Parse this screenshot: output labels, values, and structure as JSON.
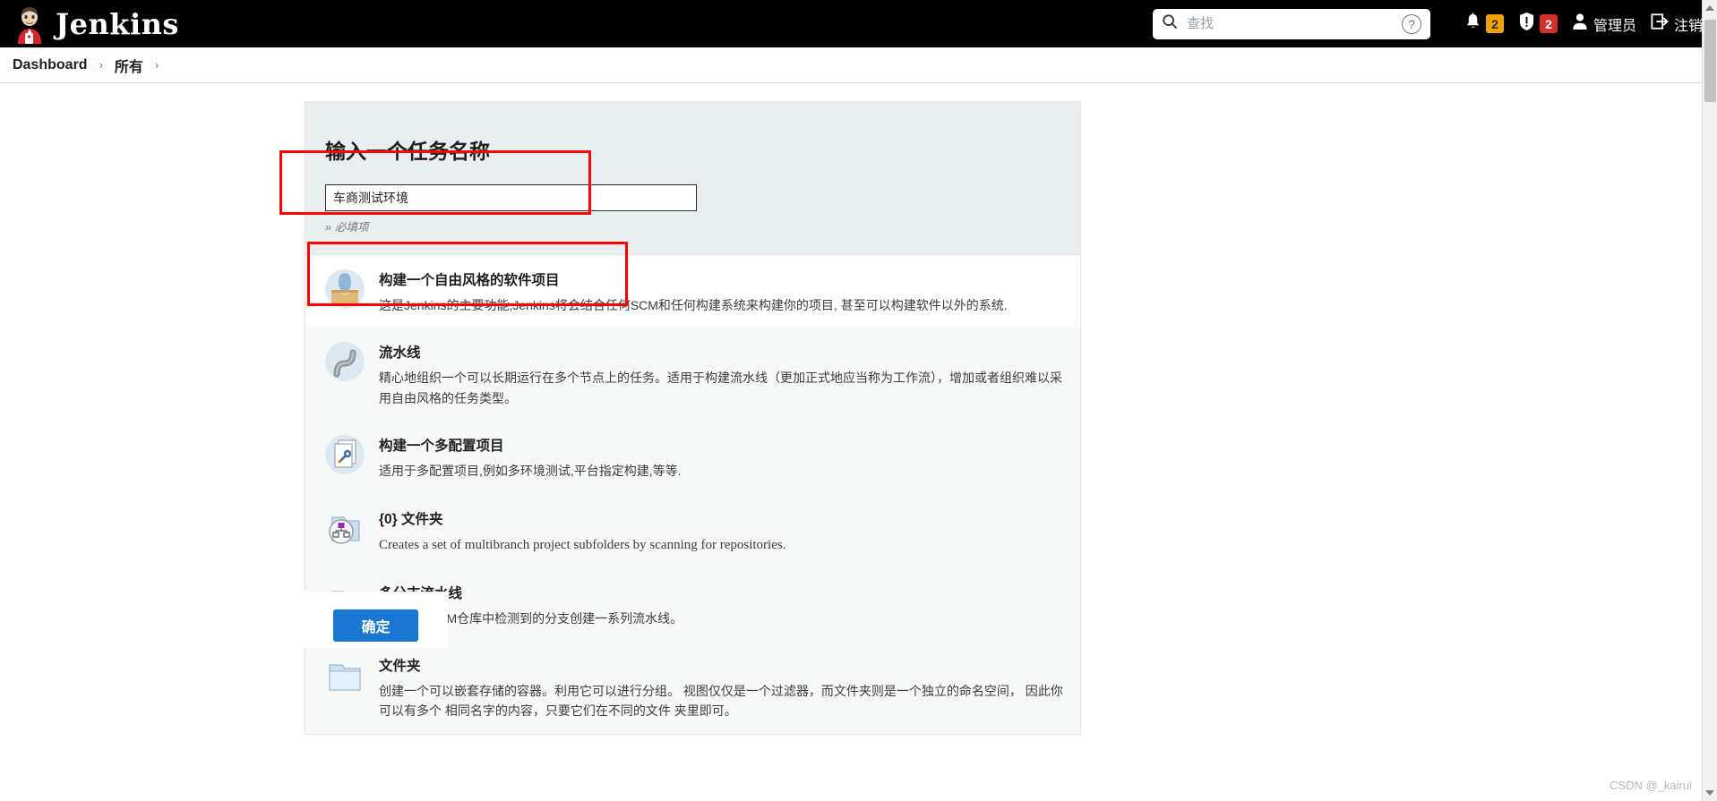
{
  "header": {
    "brand": "Jenkins",
    "logo_icon": "jenkins-butler-logo",
    "search": {
      "placeholder": "查找",
      "value": "",
      "icon": "search-icon",
      "help_icon": "help-circle-icon"
    },
    "notifications": {
      "icon": "bell-icon",
      "count": "2",
      "color": "#f0a202"
    },
    "security": {
      "icon": "shield-alert-icon",
      "count": "2",
      "color": "#d32f2f"
    },
    "user": {
      "icon": "person-icon",
      "label": "管理员"
    },
    "logout": {
      "icon": "logout-icon",
      "label": "注销"
    }
  },
  "breadcrumb": {
    "items": [
      "Dashboard",
      "所有"
    ],
    "separator": "›"
  },
  "dialog": {
    "title": "输入一个任务名称",
    "name_input": {
      "value": "车商测试环境",
      "placeholder": ""
    },
    "required_note": "必填项",
    "required_chevron": "»",
    "items": [
      {
        "icon": "freestyle-project-icon",
        "title": "构建一个自由风格的软件项目",
        "desc": "这是Jenkins的主要功能,Jenkins将会结合任何SCM和任何构建系统来构建你的项目, 甚至可以构建软件以外的系统.",
        "selected": true
      },
      {
        "icon": "pipeline-icon",
        "title": "流水线",
        "desc": "精心地组织一个可以长期运行在多个节点上的任务。适用于构建流水线（更加正式地应当称为工作流），增加或者组织难以采用自由风格的任务类型。",
        "selected": false
      },
      {
        "icon": "multi-configuration-icon",
        "title": "构建一个多配置项目",
        "desc": "适用于多配置项目,例如多环境测试,平台指定构建,等等.",
        "selected": false
      },
      {
        "icon": "organization-folder-icon",
        "title": "{0} 文件夹",
        "desc": "Creates a set of multibranch project subfolders by scanning for repositories.",
        "selected": false,
        "english": true
      },
      {
        "icon": "multibranch-pipeline-icon",
        "title": "多分支流水线",
        "desc": "根据一个SCM仓库中检测到的分支创建一系列流水线。",
        "selected": false
      },
      {
        "icon": "folder-icon",
        "title": "文件夹",
        "desc": "创建一个可以嵌套存储的容器。利用它可以进行分组。 视图仅仅是一个过滤器，而文件夹则是一个独立的命名空间， 因此你可以有多个 相同名字的内容，只要它们在不同的文件 夹里即可。",
        "selected": false
      }
    ],
    "ok_button": "确定"
  },
  "watermark": "CSDN @_kairui"
}
